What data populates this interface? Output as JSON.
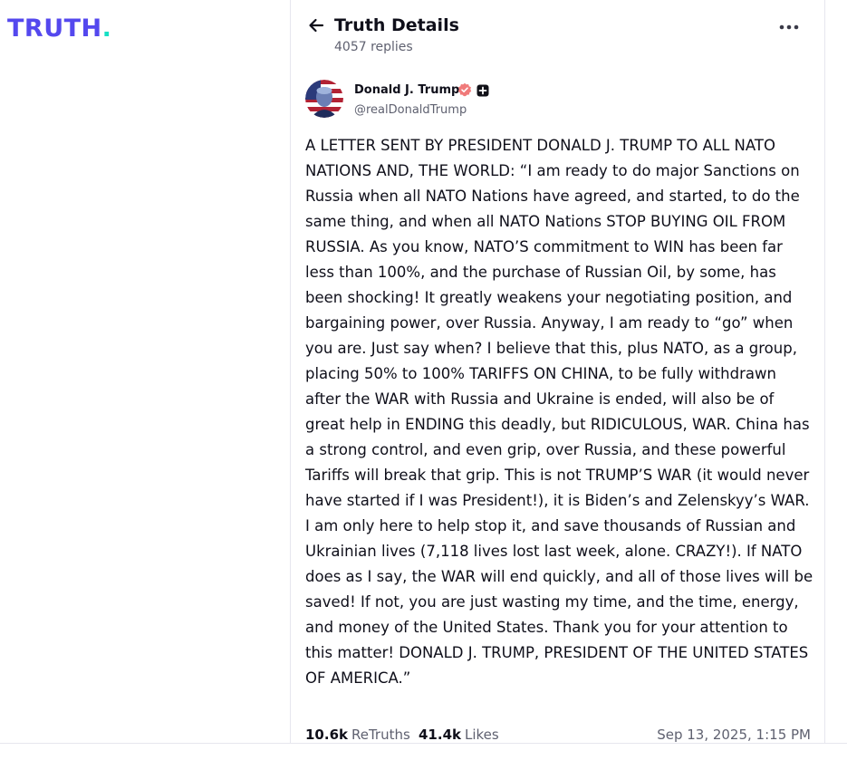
{
  "brand": {
    "logo_text": "TRUTH",
    "logo_dot": ".",
    "accent_color": "#5448ee",
    "dot_color": "#17e0c4"
  },
  "header": {
    "back_icon": "arrow-left-icon",
    "title": "Truth Details",
    "replies": "4057 replies",
    "more_icon": "ellipsis-icon"
  },
  "post": {
    "author": {
      "name": "Donald J. Trump",
      "handle": "@realDonaldTrump",
      "verified_icon": "verified-badge-icon",
      "plus_icon": "plus-badge-icon"
    },
    "text": "A LETTER SENT BY PRESIDENT DONALD J. TRUMP TO ALL NATO NATIONS AND, THE WORLD: “I am ready to do major Sanctions on Russia when all NATO Nations have agreed, and started, to do the same thing, and when all NATO Nations STOP BUYING OIL FROM RUSSIA. As you know, NATO’S commitment to WIN has been far less than 100%, and the purchase of Russian Oil, by some, has been shocking! It greatly weakens your negotiating position, and bargaining power, over Russia. Anyway, I am ready to “go” when you are. Just say when? I believe that this, plus NATO, as a group, placing 50% to 100% TARIFFS ON CHINA, to be fully withdrawn after the WAR with Russia and Ukraine is ended, will also be of great help in ENDING this deadly, but RIDICULOUS, WAR. China has a strong control, and even grip, over Russia, and these powerful Tariffs will break that grip. This is not TRUMP’S WAR (it would never have  started if I was President!), it is Biden’s and Zelenskyy’s WAR. I am only here to help stop it, and save thousands of Russian and Ukrainian lives (7,118 lives lost last week, alone. CRAZY!). If NATO does as I say, the WAR will end quickly, and all of those lives will be saved! If not, you are just wasting my time, and the time, energy, and money of the United States. Thank you for your attention to this matter! DONALD J. TRUMP, PRESIDENT OF THE UNITED STATES OF AMERICA.”",
    "stats": {
      "retruths_count": "10.6k",
      "retruths_label": "ReTruths",
      "likes_count": "41.4k",
      "likes_label": "Likes",
      "timestamp": "Sep 13, 2025, 1:15 PM"
    }
  }
}
